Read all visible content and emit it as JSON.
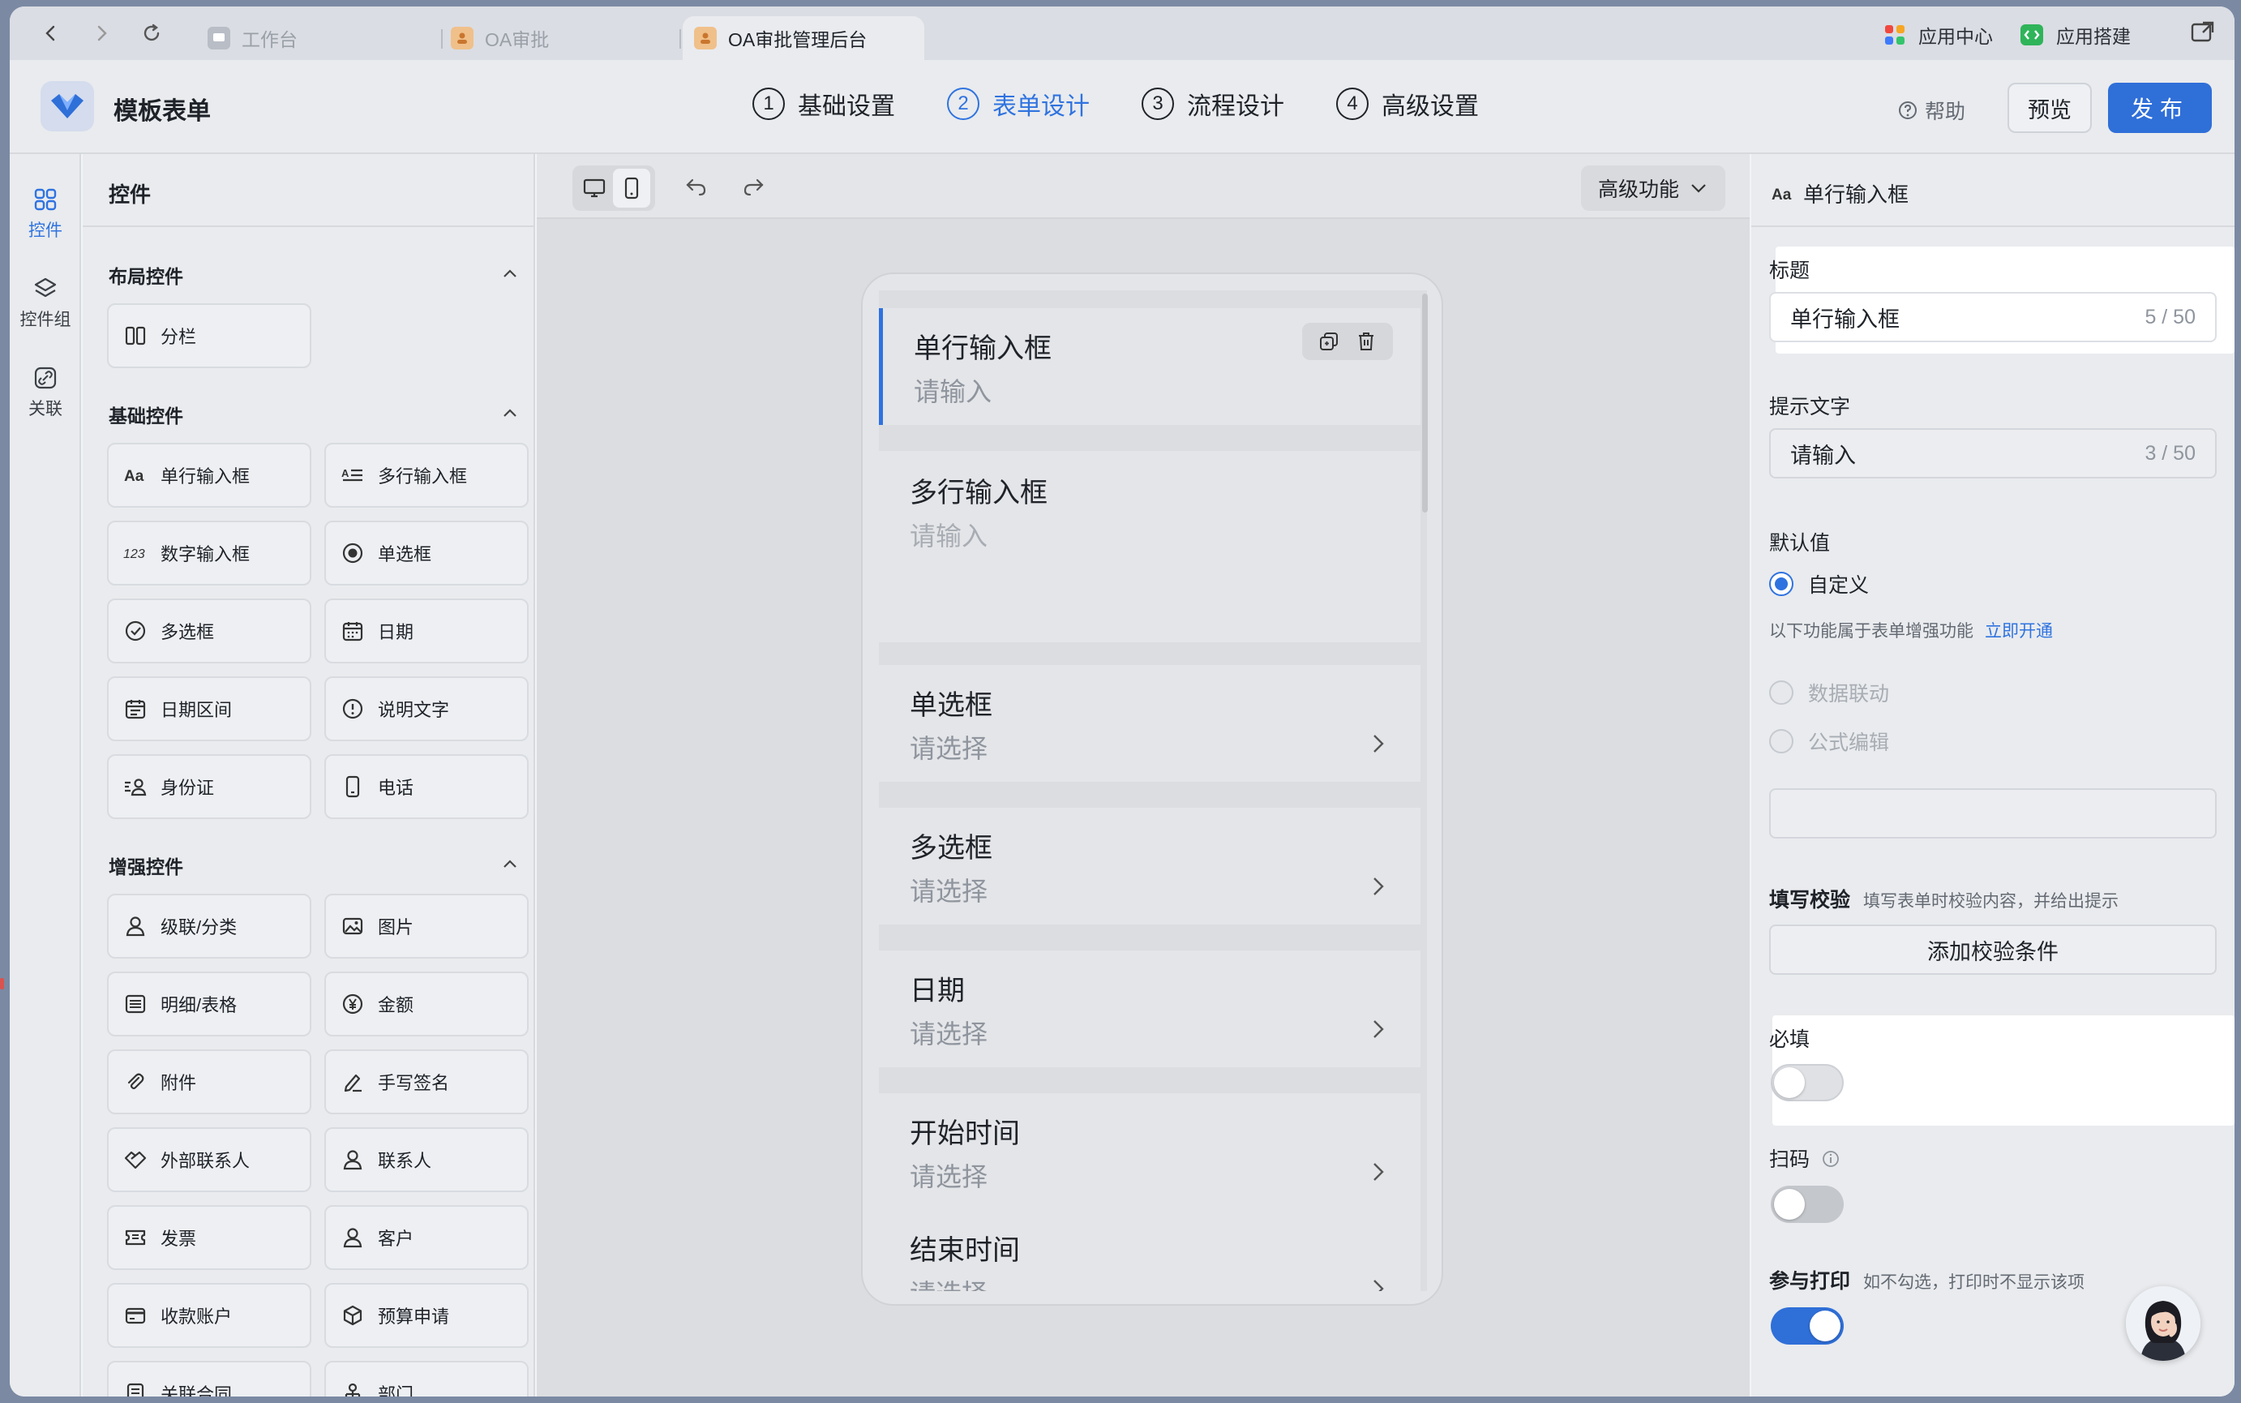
{
  "browser": {
    "tabs": [
      {
        "label": "工作台"
      },
      {
        "label": "OA审批"
      },
      {
        "label": "OA审批管理后台"
      }
    ],
    "app_center": "应用中心",
    "app_builder": "应用搭建"
  },
  "header": {
    "title": "模板表单",
    "steps": [
      {
        "num": "1",
        "label": "基础设置"
      },
      {
        "num": "2",
        "label": "表单设计"
      },
      {
        "num": "3",
        "label": "流程设计"
      },
      {
        "num": "4",
        "label": "高级设置"
      }
    ],
    "help": "帮助",
    "preview": "预览",
    "publish": "发布"
  },
  "rail": {
    "items": [
      {
        "label": "控件"
      },
      {
        "label": "控件组"
      },
      {
        "label": "关联"
      }
    ]
  },
  "controls": {
    "title": "控件",
    "layout_group": "布局控件",
    "layout_items": [
      "分栏"
    ],
    "basic_group": "基础控件",
    "basic_items": [
      "单行输入框",
      "多行输入框",
      "数字输入框",
      "单选框",
      "多选框",
      "日期",
      "日期区间",
      "说明文字",
      "身份证",
      "电话"
    ],
    "enhanced_group": "增强控件",
    "enhanced_items": [
      "级联/分类",
      "图片",
      "明细/表格",
      "金额",
      "附件",
      "手写签名",
      "外部联系人",
      "联系人",
      "发票",
      "客户",
      "收款账户",
      "预算申请",
      "关联合同",
      "部门"
    ]
  },
  "canvas": {
    "advanced": "高级功能",
    "fields": [
      {
        "label": "单行输入框",
        "placeholder": "请输入"
      },
      {
        "label": "多行输入框",
        "placeholder": "请输入"
      },
      {
        "label": "单选框",
        "placeholder": "请选择"
      },
      {
        "label": "多选框",
        "placeholder": "请选择"
      },
      {
        "label": "日期",
        "placeholder": "请选择"
      },
      {
        "label": "开始时间",
        "placeholder": "请选择"
      },
      {
        "label": "结束时间",
        "placeholder": "请选择"
      }
    ]
  },
  "props": {
    "header": "单行输入框",
    "title_label": "标题",
    "title_value": "单行输入框",
    "title_count": "5 / 50",
    "hint_label": "提示文字",
    "hint_value": "请输入",
    "hint_count": "3 / 50",
    "default_label": "默认值",
    "default_custom": "自定义",
    "enhance_note": "以下功能属于表单增强功能",
    "enhance_link": "立即开通",
    "data_link": "数据联动",
    "formula": "公式编辑",
    "validate_label": "填写校验",
    "validate_note": "填写表单时校验内容，并给出提示",
    "validate_btn": "添加校验条件",
    "required_label": "必填",
    "scan_label": "扫码",
    "print_label": "参与打印",
    "print_note": "如不勾选，打印时不显示该项",
    "required_on": false,
    "scan_on": false,
    "print_on": true
  },
  "colors": {
    "accent": "#2f73e0",
    "publish": "#2f6fd8"
  }
}
